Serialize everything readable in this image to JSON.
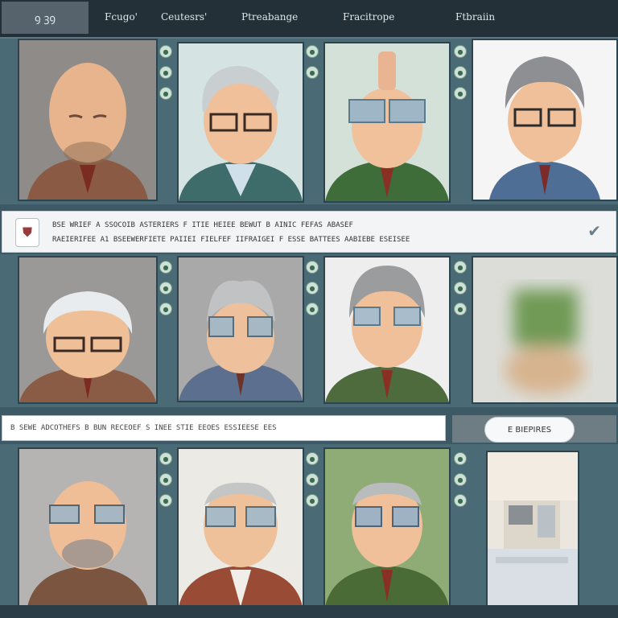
{
  "header": {
    "logo": "ꝯ ꝫꝯ",
    "tabs": [
      "Fcugo'",
      "Ceutesrs'",
      "Ptreabange",
      "Fracitrope",
      "Ftbraiin"
    ]
  },
  "info_bar": {
    "line1": "BSE WRIEF A SSOCOIB ASTERIERS F ITIE HEIEE BEWUT B AINIC FEFAS ABASEF",
    "line2": "RAEIERIFEE A1 BSEEWERFIETE PAIIEI FIELFEF IIFRAIGEI F ESSE BATTEES AABIEBE ESEISEE"
  },
  "search": {
    "text": "B SEWE ADCOTHEFS B BUN RECEOEF S INEE STIE EEOES ESSIEESE EES"
  },
  "action_button": {
    "label": "E BIEPIRES"
  },
  "colors": {
    "accent": "#4a6a76",
    "header": "#233038"
  }
}
